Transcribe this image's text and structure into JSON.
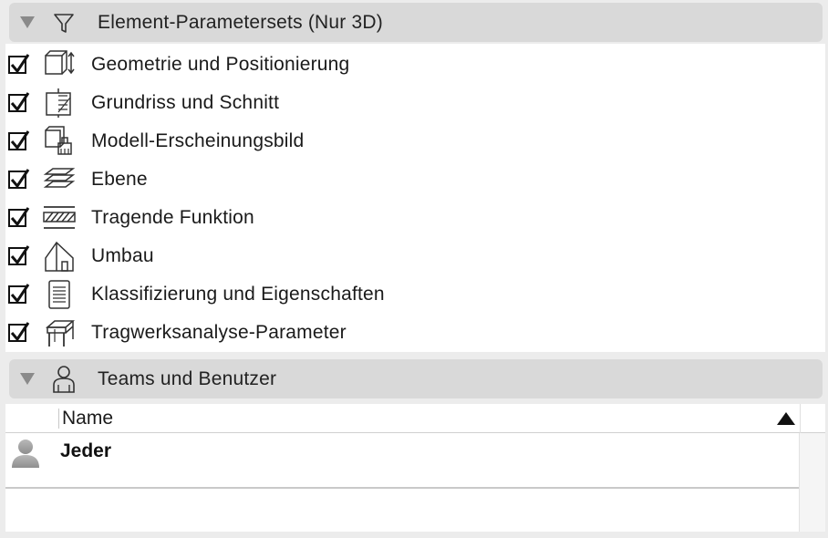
{
  "element_params": {
    "title": "Element-Parametersets (Nur 3D)",
    "header_icon": "filter-icon",
    "items": [
      {
        "label": "Geometrie und Positionierung",
        "icon": "geometry-position-icon",
        "checked": true
      },
      {
        "label": "Grundriss und Schnitt",
        "icon": "floorplan-section-icon",
        "checked": true
      },
      {
        "label": "Modell-Erscheinungsbild",
        "icon": "model-appearance-icon",
        "checked": true
      },
      {
        "label": "Ebene",
        "icon": "layers-icon",
        "checked": true
      },
      {
        "label": "Tragende Funktion",
        "icon": "structural-function-icon",
        "checked": true
      },
      {
        "label": "Umbau",
        "icon": "renovation-icon",
        "checked": true
      },
      {
        "label": "Klassifizierung und Eigenschaften",
        "icon": "classification-document-icon",
        "checked": true
      },
      {
        "label": "Tragwerksanalyse-Parameter",
        "icon": "structural-analysis-icon",
        "checked": true
      }
    ]
  },
  "teams": {
    "title": "Teams und Benutzer",
    "header_icon": "user-icon",
    "column_header": "Name",
    "sort": "ascending",
    "rows": [
      {
        "name": "Jeder",
        "icon": "user-avatar-icon"
      }
    ]
  },
  "colors": {
    "background": "#ececec",
    "header_bar": "#d9d9d9",
    "panel": "#ffffff",
    "text": "#1a1a1a"
  }
}
